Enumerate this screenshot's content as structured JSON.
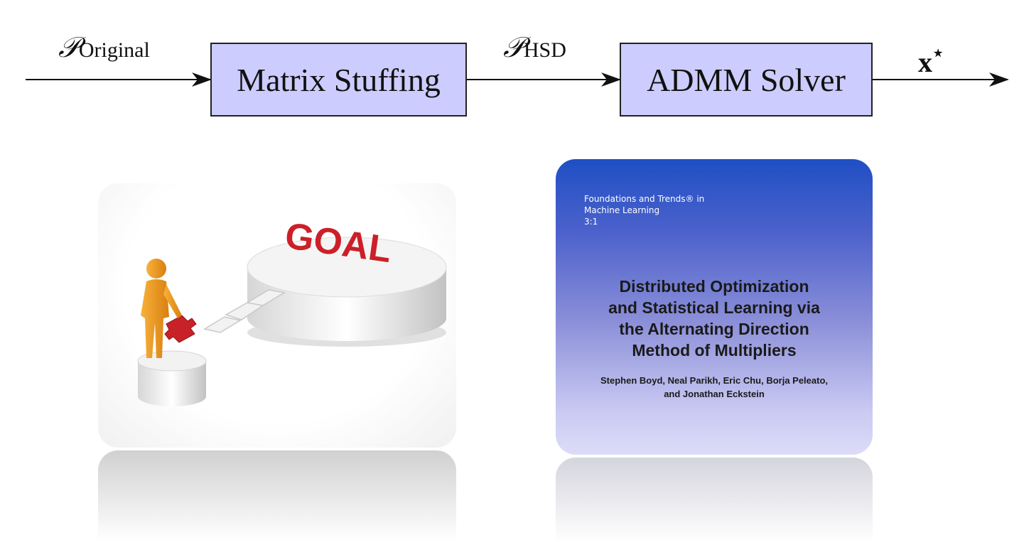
{
  "pipeline": {
    "input": {
      "symbol": "𝒫",
      "subscript": "Original"
    },
    "stage1": {
      "label": "Matrix Stuffing"
    },
    "intermediate": {
      "symbol": "𝒫",
      "subscript": "HSD"
    },
    "stage2": {
      "label": "ADMM Solver"
    },
    "output": {
      "label": "x",
      "superscript": "⋆"
    },
    "box_fill": "#ccccff"
  },
  "goal_image": {
    "word": "GOAL",
    "word_color": "#cc1f27",
    "figure_color": "#f29a1a"
  },
  "book_cover": {
    "series": "Foundations and Trends® in",
    "series_line2": "Machine Learning",
    "volume": "3:1",
    "title_lines": [
      "Distributed Optimization",
      "and Statistical Learning via",
      "the Alternating Direction",
      "Method of Multipliers"
    ],
    "author_lines": [
      "Stephen Boyd, Neal Parikh, Eric Chu, Borja Peleato,",
      "and Jonathan Eckstein"
    ]
  }
}
